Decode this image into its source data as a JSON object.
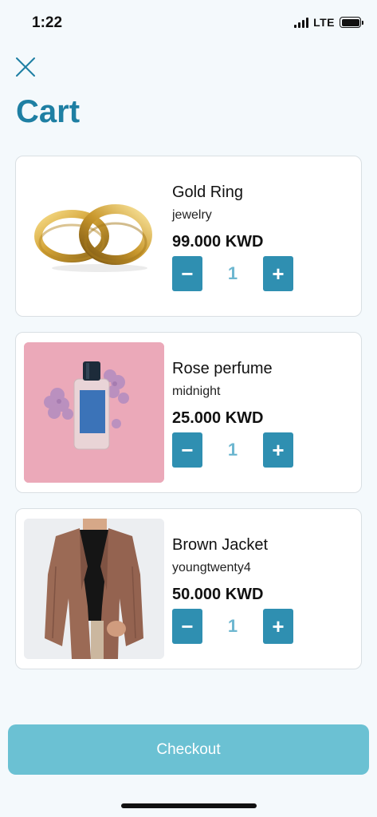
{
  "status_bar": {
    "time": "1:22",
    "network": "LTE"
  },
  "header": {
    "title": "Cart",
    "close_icon": "close-icon"
  },
  "cart": {
    "items": [
      {
        "name": "Gold Ring",
        "brand": "jewelry",
        "price": "99.000 KWD",
        "quantity": "1",
        "image": "gold-rings-image"
      },
      {
        "name": "Rose perfume",
        "brand": "midnight",
        "price": "25.000 KWD",
        "quantity": "1",
        "image": "perfume-bottle-image"
      },
      {
        "name": "Brown Jacket",
        "brand": "youngtwenty4",
        "price": "50.000 KWD",
        "quantity": "1",
        "image": "brown-jacket-image"
      }
    ],
    "minus_label": "−",
    "plus_label": "+"
  },
  "checkout": {
    "label": "Checkout"
  },
  "colors": {
    "accent": "#1e7fa3",
    "button": "#2f8fb1",
    "checkout": "#6bc1d3",
    "quantity_text": "#6eb7d0",
    "background": "#f4f9fc"
  }
}
